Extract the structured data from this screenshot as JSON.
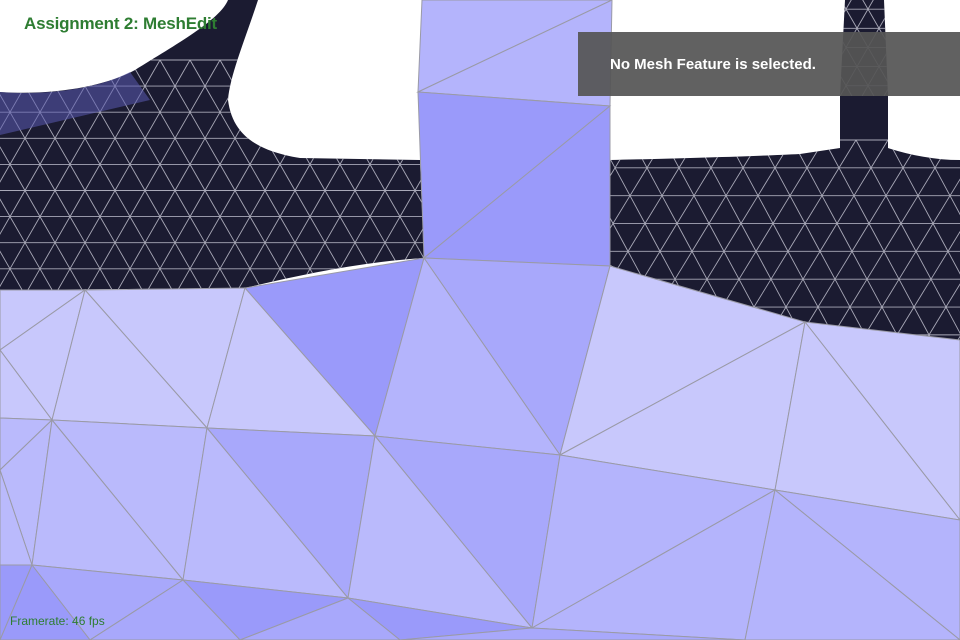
{
  "app": {
    "title": "Assignment 2: MeshEdit",
    "title_color": "#2e7d32"
  },
  "info_panel": {
    "message": "No Mesh Feature is selected."
  },
  "status": {
    "framerate_label": "Framerate: 46 fps",
    "framerate_color": "#2e7d32"
  },
  "colors": {
    "background": "#ffffff",
    "dark_face": "#1b1b31",
    "light_faces": [
      "#c8c8fc",
      "#babafc",
      "#a8a8fb",
      "#9a9afa",
      "#b4b4fc"
    ],
    "mesh_edge": "#9a9aa6"
  }
}
